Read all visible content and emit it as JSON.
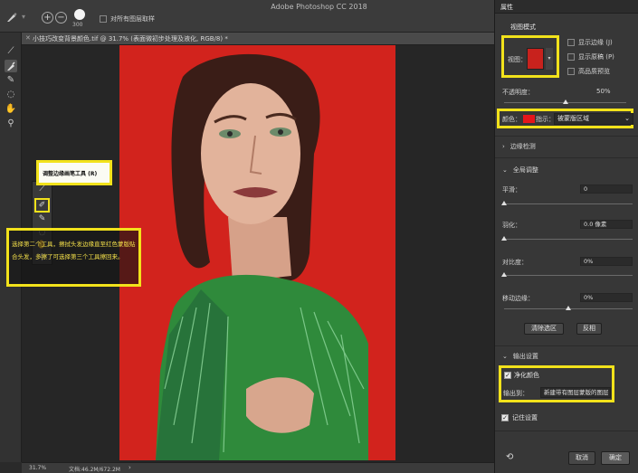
{
  "app": {
    "title": "Adobe Photoshop CC 2018"
  },
  "options_bar": {
    "brush_size": "300",
    "sample_all_layers": "对所有图层取样"
  },
  "document": {
    "tab_label": "小技巧改变背景颜色.tif @ 31.7% (表面微初步处理及液化, RGB/8) *"
  },
  "flyout": {
    "tooltip": "调整边缘画笔工具 (R)"
  },
  "annotation": {
    "text": "选择第二个工具，擦拭头发边缘直至红色蒙版贴合头发，多擦了可选择第三个工具擦回来。"
  },
  "status": {
    "zoom": "31.7%",
    "doc_info": "文档:46.2M/672.2M",
    "arrow": "›"
  },
  "panel": {
    "tab_label": "属性",
    "view_mode_label": "视图模式",
    "view_label": "视图：",
    "show_edge": "显示边缘 (J)",
    "show_original": "显示原稿 (P)",
    "high_quality": "高品质预览",
    "opacity_label": "不透明度：",
    "opacity_value": "50%",
    "color_label": "颜色：",
    "hint_label": "指示：",
    "hint_value": "被蒙版区域",
    "edge_detection": "边缘检测",
    "global_refine": "全局调整",
    "smooth_label": "平滑：",
    "smooth_value": "0",
    "feather_label": "羽化：",
    "feather_value": "0.0 像素",
    "contrast_label": "对比度：",
    "contrast_value": "0%",
    "shift_edge_label": "移动边缘：",
    "shift_edge_value": "0%",
    "clear_selection": "清除选区",
    "invert": "反相",
    "output_settings": "输出设置",
    "decontaminate": "净化颜色",
    "output_to_label": "输出到：",
    "output_to_value": "新建带有图层蒙版的图层",
    "remember": "记住设置",
    "cancel": "取消",
    "ok": "确定"
  },
  "colors": {
    "highlight": "#f2e21b",
    "photo_bg": "#d2231d",
    "mask_color": "#e6161a"
  },
  "progress": {
    "opacity": 0.5,
    "smooth": 0,
    "feather": 0,
    "contrast": 0,
    "shift_edge": 0.5
  }
}
